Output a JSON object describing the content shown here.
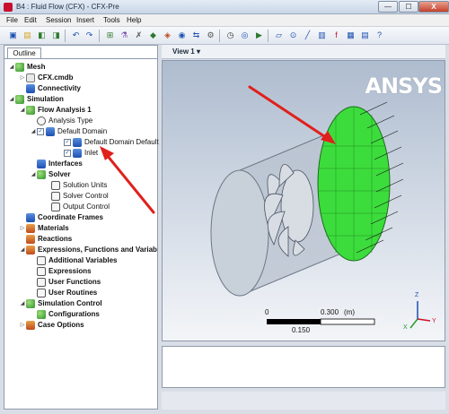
{
  "window": {
    "title": "B4 : Fluid Flow (CFX) - CFX-Pre",
    "minimize_glyph": "—",
    "maximize_glyph": "☐",
    "close_glyph": "X"
  },
  "menu": [
    "File",
    "Edit",
    "Session",
    "Insert",
    "Tools",
    "Help"
  ],
  "toolbar": {
    "icons": [
      "save-icon",
      "open-icon",
      "import-icon",
      "export-icon",
      "undo-icon",
      "redo-icon",
      "mesh-import-icon",
      "flask-icon",
      "tools-icon",
      "domain-icon",
      "boundary-icon",
      "subdomain-icon",
      "interface-icon",
      "solver-icon",
      "clock-icon",
      "monitor-icon",
      "run-icon",
      "plane-icon",
      "point-icon",
      "line-icon",
      "volume-icon",
      "expression-icon",
      "chart-icon",
      "table-icon",
      "help-icon"
    ]
  },
  "outline": {
    "tab_label": "Outline",
    "tree": [
      {
        "label": "Mesh",
        "bold": true,
        "icon": "mesh-icon",
        "expanded": true
      },
      {
        "label": "CFX.cmdb",
        "bold": true,
        "icon": "mesh-file-icon"
      },
      {
        "label": "Connectivity",
        "bold": true,
        "icon": "connectivity-icon"
      },
      {
        "label": "Simulation",
        "bold": true,
        "icon": "simulation-icon",
        "expanded": true
      },
      {
        "label": "Flow Analysis 1",
        "bold": true,
        "icon": "flow-analysis-icon",
        "expanded": true
      },
      {
        "label": "Analysis Type",
        "bold": false,
        "icon": "clock-icon"
      },
      {
        "label": "Default Domain",
        "bold": false,
        "icon": "domain-icon",
        "checked": true,
        "expanded": true
      },
      {
        "label": "Default Domain Default",
        "bold": false,
        "icon": "boundary-icon",
        "checked": true
      },
      {
        "label": "Inlet",
        "bold": false,
        "icon": "inlet-icon",
        "checked": true
      },
      {
        "label": "Interfaces",
        "bold": true,
        "icon": "interfaces-icon"
      },
      {
        "label": "Solver",
        "bold": true,
        "icon": "solver-icon",
        "expanded": true
      },
      {
        "label": "Solution Units",
        "bold": false,
        "icon": "units-icon"
      },
      {
        "label": "Solver Control",
        "bold": false,
        "icon": "solver-control-icon"
      },
      {
        "label": "Output Control",
        "bold": false,
        "icon": "output-control-icon"
      },
      {
        "label": "Coordinate Frames",
        "bold": true,
        "icon": "coordinate-icon"
      },
      {
        "label": "Materials",
        "bold": true,
        "icon": "materials-icon"
      },
      {
        "label": "Reactions",
        "bold": true,
        "icon": "reactions-icon"
      },
      {
        "label": "Expressions, Functions and Variab",
        "bold": true,
        "icon": "expressions-folder-icon",
        "expanded": true
      },
      {
        "label": "Additional Variables",
        "bold": true,
        "icon": "variables-icon"
      },
      {
        "label": "Expressions",
        "bold": true,
        "icon": "expression-icon"
      },
      {
        "label": "User Functions",
        "bold": true,
        "icon": "function-icon"
      },
      {
        "label": "User Routines",
        "bold": true,
        "icon": "routine-icon"
      },
      {
        "label": "Simulation Control",
        "bold": true,
        "icon": "simulation-control-icon",
        "expanded": true
      },
      {
        "label": "Configurations",
        "bold": true,
        "icon": "configurations-icon"
      },
      {
        "label": "Case Options",
        "bold": true,
        "icon": "case-options-icon"
      }
    ]
  },
  "viewport": {
    "view_label": "View 1",
    "dropdown_glyph": "▾",
    "logo": "ANSYS",
    "scale": {
      "left_label": "0",
      "right_label": "0.300",
      "unit": "(m)",
      "mid_label": "0.150"
    },
    "axis_labels": {
      "x": "X",
      "y": "Y",
      "z": "Z"
    },
    "inlet_color": "#3ddc3d",
    "arrow_color": "#e0201c"
  }
}
